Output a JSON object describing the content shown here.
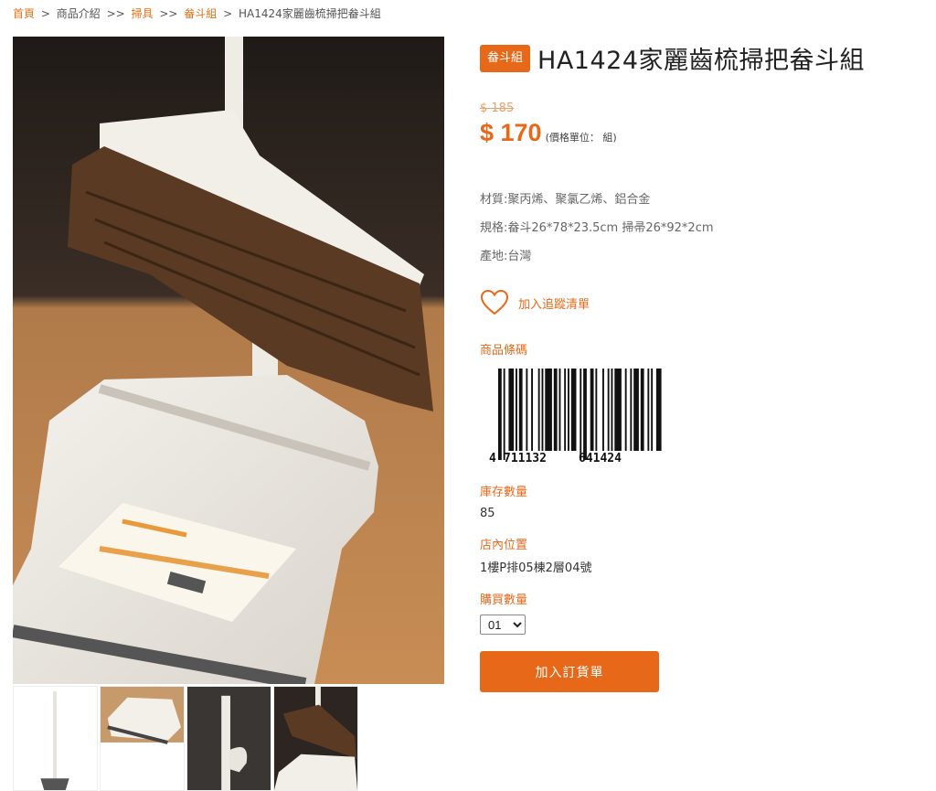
{
  "breadcrumb": {
    "home": "首頁",
    "sep1": ">",
    "products": "商品介紹",
    "sep2": ">>",
    "category": "掃具",
    "sep3": ">>",
    "subcategory": "畚斗組",
    "sep4": ">",
    "current": "HA1424家麗齒梳掃把畚斗組"
  },
  "product": {
    "badge": "畚斗組",
    "title": "HA1424家麗齒梳掃把畚斗組",
    "old_price": "$ 185",
    "price": "$ 170",
    "price_unit": "(價格單位： 組)",
    "specs": [
      "材質:聚丙烯、聚氯乙烯、鋁合金",
      "規格:畚斗26*78*23.5cm 掃帚26*92*2cm",
      "產地:台灣"
    ],
    "wishlist_label": "加入追蹤清單",
    "barcode_label": "商品條碼",
    "barcode_digits": {
      "first": "4",
      "left": "711132",
      "right": "641424"
    },
    "stock_label": "庫存數量",
    "stock_value": "85",
    "location_label": "店內位置",
    "location_value": "1樓P排05棟2層04號",
    "quantity_label": "購買數量",
    "quantity_selected": "01",
    "order_button": "加入訂貨單"
  },
  "colors": {
    "accent": "#e8681a",
    "text": "#333333"
  },
  "icons": {
    "wishlist": "heart-icon"
  }
}
